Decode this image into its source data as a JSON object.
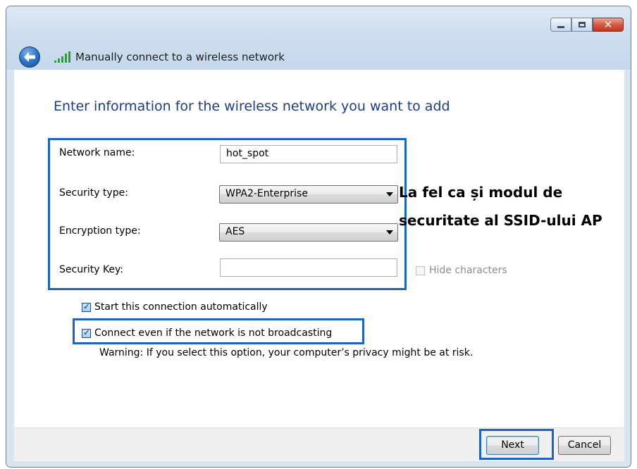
{
  "window": {
    "title": "Manually connect to a wireless network"
  },
  "main": {
    "heading": "Enter information for the wireless network you want to add",
    "fields": {
      "network_name": {
        "label": "Network name:",
        "value": "hot_spot"
      },
      "security_type": {
        "label": "Security type:",
        "value": "WPA2-Enterprise"
      },
      "encryption_type": {
        "label": "Encryption type:",
        "value": "AES"
      },
      "security_key": {
        "label": "Security Key:",
        "value": ""
      }
    },
    "hide_characters": {
      "label": "Hide characters",
      "checked": false
    },
    "start_auto": {
      "label": "Start this connection automatically",
      "checked": true
    },
    "connect_even": {
      "label": "Connect even if the network is not broadcasting",
      "checked": true
    },
    "warning": "Warning: If you select this option, your computer’s privacy might be at risk."
  },
  "annotation": {
    "line1": "La fel ca și modul de",
    "line2": "securitate al SSID-ului AP"
  },
  "footer": {
    "next_label": "Next",
    "cancel_label": "Cancel"
  },
  "colors": {
    "highlight": "#1e63c8",
    "heading": "#1e3c8a"
  },
  "icons": [
    "back-arrow-icon",
    "wireless-signal-icon",
    "minimize-icon",
    "maximize-icon",
    "close-icon",
    "dropdown-arrow-icon",
    "checkmark-icon"
  ]
}
